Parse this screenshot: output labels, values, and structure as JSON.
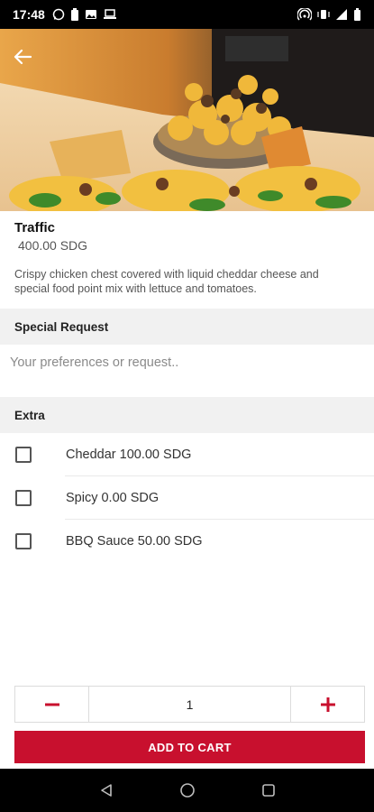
{
  "status_bar": {
    "time": "17:48",
    "left_icons": [
      "whatsapp-icon",
      "battery-icon",
      "image-icon",
      "laptop-icon"
    ],
    "right_icons": [
      "hotspot-icon",
      "vibrate-icon",
      "signal-icon",
      "battery-icon"
    ]
  },
  "hero": {
    "image_name": "food-photo",
    "back_icon": "arrow-left-icon"
  },
  "item": {
    "title": "Traffic",
    "price": "400.00 SDG",
    "description": "Crispy chicken chest covered with liquid cheddar cheese and special food point mix with lettuce and tomatoes."
  },
  "special_request": {
    "heading": "Special Request",
    "placeholder": "Your preferences or request..",
    "value": ""
  },
  "extra": {
    "heading": "Extra",
    "items": [
      {
        "label": "Cheddar  100.00 SDG",
        "checked": false
      },
      {
        "label": "Spicy  0.00 SDG",
        "checked": false
      },
      {
        "label": "BBQ Sauce  50.00 SDG",
        "checked": false
      }
    ]
  },
  "quantity": {
    "value": "1",
    "minus_icon": "minus-icon",
    "plus_icon": "plus-icon"
  },
  "add_to_cart": {
    "label": "ADD TO CART"
  },
  "nav_bar": {
    "icons": [
      "back-triangle-icon",
      "home-circle-icon",
      "recents-square-icon"
    ]
  },
  "colors": {
    "accent": "#c8102e",
    "section_bg": "#f1f1f1",
    "status_bg": "#000000"
  }
}
